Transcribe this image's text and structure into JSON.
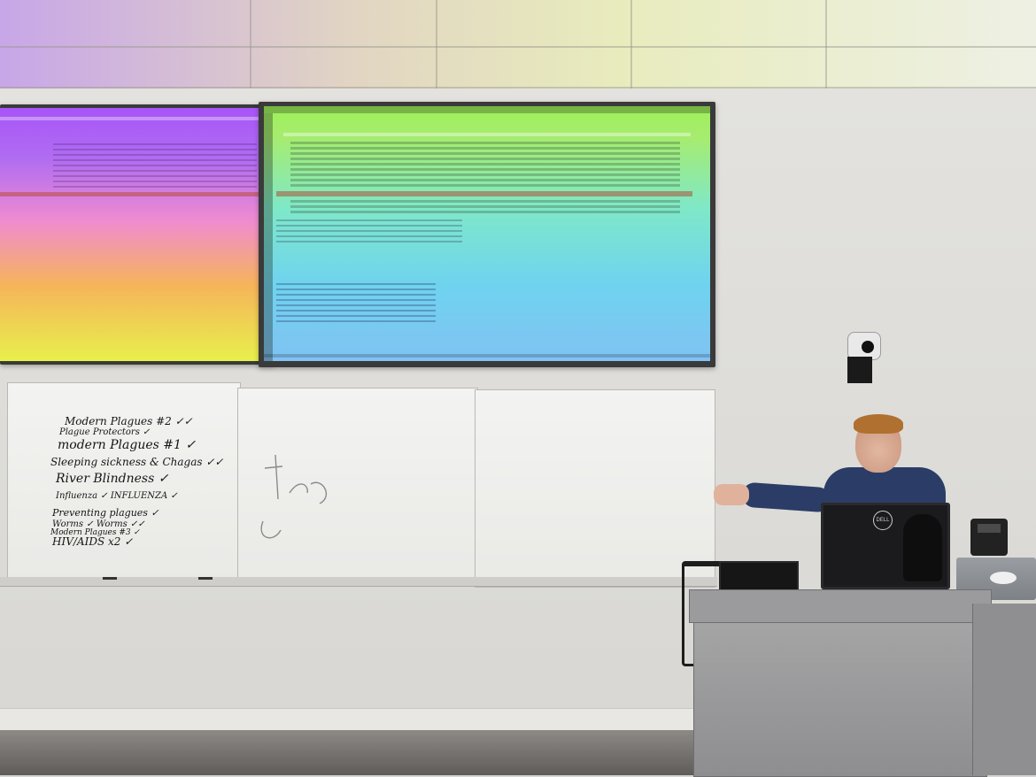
{
  "scene": {
    "description_tag": "classroom-lecture"
  },
  "whiteboard_notes": [
    "Modern Plagues #2 ✓✓",
    "Plague Protectors ✓",
    "modern Plagues #1 ✓",
    "Sleeping sickness & Chagas ✓✓",
    "River Blindness ✓",
    "Influenza ✓   INFLUENZA ✓",
    "Preventing plagues ✓",
    "Worms ✓   Worms ✓✓",
    "Modern Plagues #3 ✓",
    "HIV/AIDS x2 ✓"
  ],
  "monitor_logo": "DELL",
  "colors": {
    "screen_left_top": "#a855f7",
    "screen_left_bottom": "#e8f04c",
    "screen_right_top": "#9ef05a",
    "screen_right_bottom": "#80c2f3",
    "shirt": "#2b3d66",
    "hair": "#b0702f"
  }
}
